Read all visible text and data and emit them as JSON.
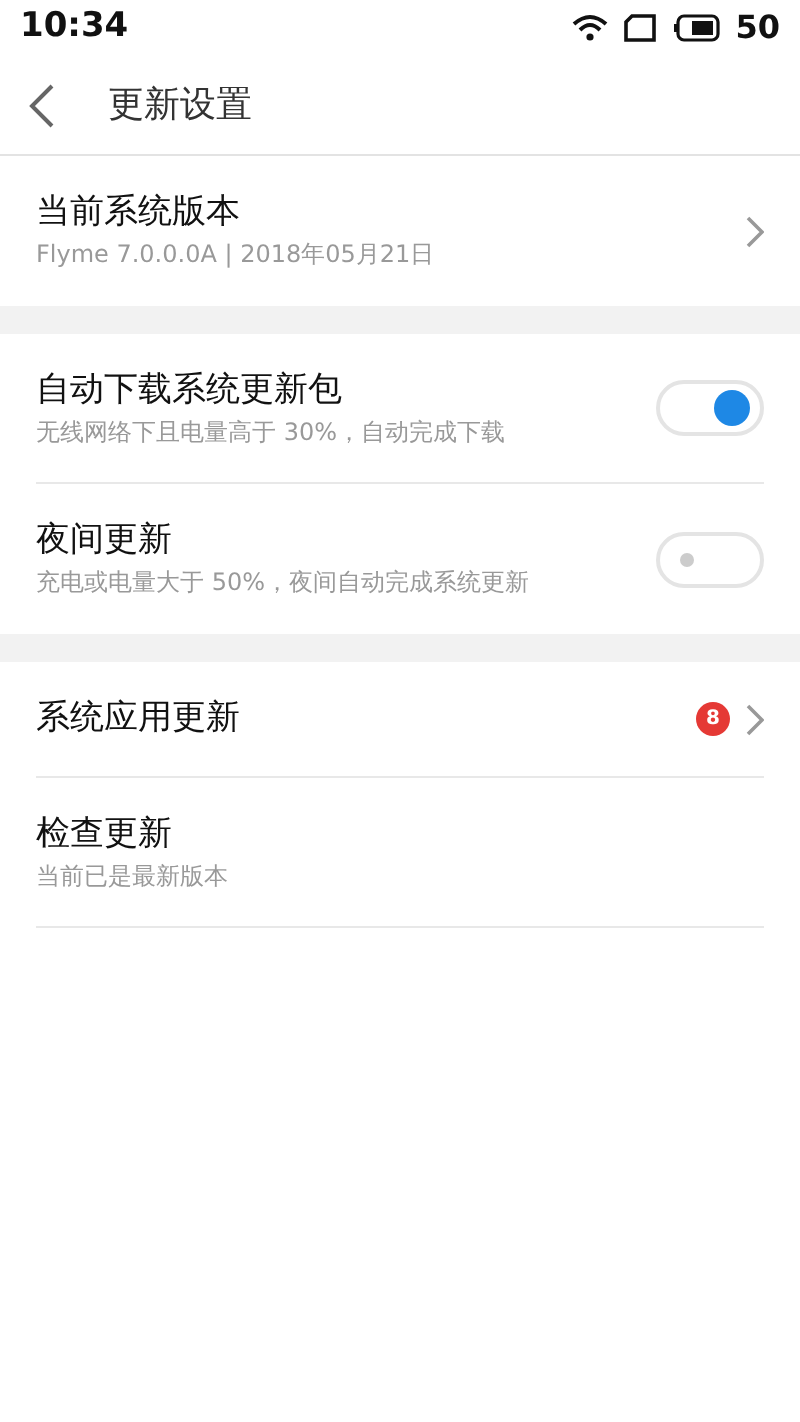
{
  "status_bar": {
    "time": "10:34",
    "battery": "50"
  },
  "header": {
    "title": "更新设置"
  },
  "sections": [
    {
      "rows": [
        {
          "kind": "chevron",
          "title": "当前系统版本",
          "subtitle": "Flyme 7.0.0.0A | 2018年05月21日"
        }
      ]
    },
    {
      "rows": [
        {
          "kind": "toggle",
          "title": "自动下载系统更新包",
          "subtitle": "无线网络下且电量高于 30%，自动完成下载",
          "on": true
        },
        {
          "kind": "toggle",
          "title": "夜间更新",
          "subtitle": "充电或电量大于 50%，夜间自动完成系统更新",
          "on": false
        }
      ]
    },
    {
      "rows": [
        {
          "kind": "chevron",
          "title": "系统应用更新",
          "badge": "8"
        },
        {
          "kind": "plain",
          "title": "检查更新",
          "subtitle": "当前已是最新版本"
        }
      ]
    }
  ]
}
